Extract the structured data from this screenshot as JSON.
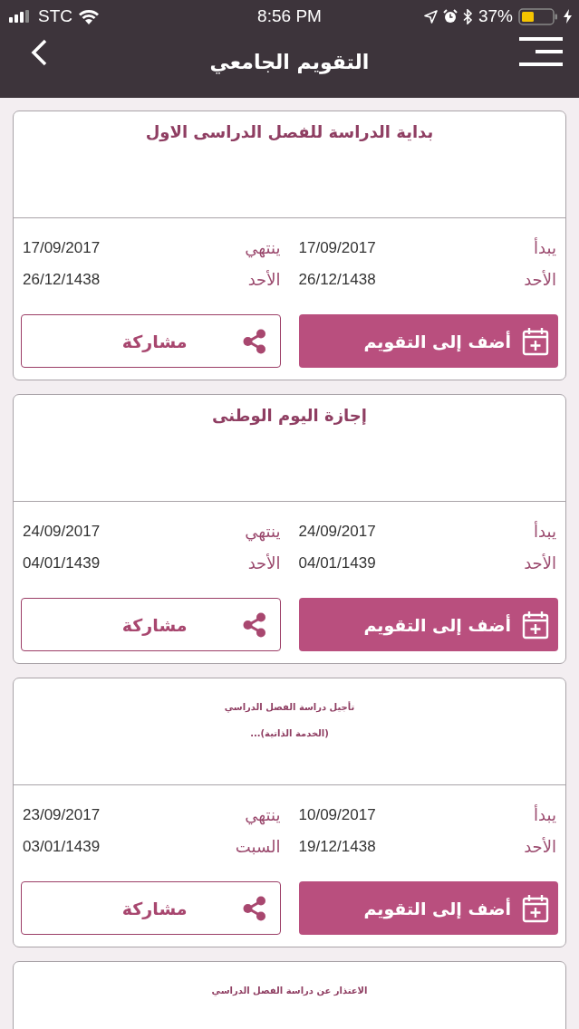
{
  "status_bar": {
    "carrier": "STC",
    "time": "8:56 PM",
    "battery": "37%"
  },
  "nav": {
    "title": "التقويم الجامعي"
  },
  "events": [
    {
      "kind": "large",
      "title": [
        "بداية الدراسة للفصل الدراسى الاول"
      ],
      "start": {
        "label": "يبدأ",
        "gregorian": "17/09/2017",
        "day": "الأحد",
        "hijri": "26/12/1438"
      },
      "end": {
        "label": "ينتهي",
        "gregorian": "17/09/2017",
        "day": "الأحد",
        "hijri": "26/12/1438"
      },
      "add_button": "أضف إلى التقويم",
      "share_button": "مشاركة"
    },
    {
      "kind": "large",
      "title": [
        "إجازة اليوم الوطنى"
      ],
      "start": {
        "label": "يبدأ",
        "gregorian": "24/09/2017",
        "day": "الأحد",
        "hijri": "04/01/1439"
      },
      "end": {
        "label": "ينتهي",
        "gregorian": "24/09/2017",
        "day": "الأحد",
        "hijri": "04/01/1439"
      },
      "add_button": "أضف إلى التقويم",
      "share_button": "مشاركة"
    },
    {
      "kind": "small",
      "title": [
        "تأجيل دراسة الفصل الدراسي",
        "(الخدمة الذاتية)..."
      ],
      "start": {
        "label": "يبدأ",
        "gregorian": "10/09/2017",
        "day": "الأحد",
        "hijri": "19/12/1438"
      },
      "end": {
        "label": "ينتهي",
        "gregorian": "23/09/2017",
        "day": "السبت",
        "hijri": "03/01/1439"
      },
      "add_button": "أضف إلى التقويم",
      "share_button": "مشاركة"
    },
    {
      "kind": "small",
      "title": [
        "الاعتذار عن دراسة الفصل الدراسي"
      ]
    }
  ]
}
